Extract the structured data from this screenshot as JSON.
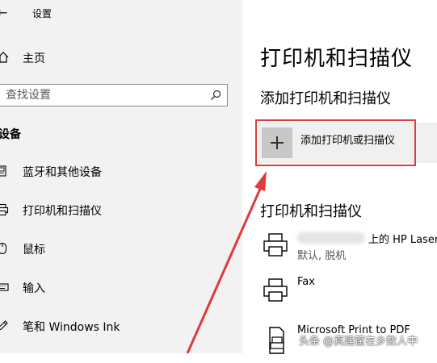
{
  "window": {
    "title": "设置"
  },
  "sidebar": {
    "home_label": "主页",
    "search_placeholder": "查找设置",
    "section_title": "设备",
    "items": [
      {
        "label": "蓝牙和其他设备",
        "icon": "bluetooth-devices-icon"
      },
      {
        "label": "打印机和扫描仪",
        "icon": "printer-icon"
      },
      {
        "label": "鼠标",
        "icon": "mouse-icon"
      },
      {
        "label": "输入",
        "icon": "keyboard-icon"
      },
      {
        "label": "笔和 Windows Ink",
        "icon": "pen-icon"
      }
    ]
  },
  "main": {
    "page_title": "打印机和扫描仪",
    "add_section_title": "添加打印机和扫描仪",
    "add_button_label": "添加打印机或扫描仪",
    "printers_heading": "打印机和扫描仪",
    "printers": [
      {
        "name_suffix": "上的 HP Laser",
        "status": "默认, 脱机"
      },
      {
        "name": "Fax"
      },
      {
        "name": "Microsoft Print to PDF"
      }
    ]
  },
  "annotation": {
    "highlight_color": "#e03a3a"
  },
  "watermark": "头条 @真建筐在乡数人中"
}
